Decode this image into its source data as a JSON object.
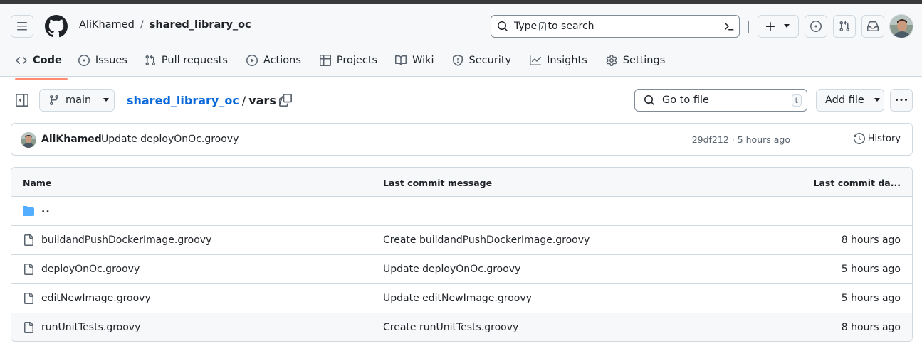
{
  "header": {
    "owner": "AliKhamed",
    "separator": "/",
    "repo": "shared_library_oc",
    "search": {
      "text_before": "Type",
      "key": "/",
      "text_after": "to search"
    },
    "plus_label": "+"
  },
  "tabs": [
    {
      "label": "Code",
      "icon": "code-icon",
      "active": true
    },
    {
      "label": "Issues",
      "icon": "issue-opened-icon"
    },
    {
      "label": "Pull requests",
      "icon": "git-pull-request-icon"
    },
    {
      "label": "Actions",
      "icon": "play-icon"
    },
    {
      "label": "Projects",
      "icon": "table-icon"
    },
    {
      "label": "Wiki",
      "icon": "book-icon"
    },
    {
      "label": "Security",
      "icon": "shield-icon"
    },
    {
      "label": "Insights",
      "icon": "graph-icon"
    },
    {
      "label": "Settings",
      "icon": "gear-icon"
    }
  ],
  "toolbar": {
    "branch": "main",
    "path_repo": "shared_library_oc",
    "path_sep": "/",
    "path_current": "vars",
    "path_trailing": "/",
    "goto_file": "Go to file",
    "goto_key": "t",
    "add_file": "Add file"
  },
  "commit": {
    "author": "AliKhamed",
    "message": "Update deployOnOc.groovy",
    "meta": "29df212 · 5 hours ago",
    "history_label": "History"
  },
  "table": {
    "headers": {
      "name": "Name",
      "message": "Last commit message",
      "date": "Last commit da..."
    },
    "parent_label": "..",
    "rows": [
      {
        "name": "buildandPushDockerImage.groovy",
        "message": "Create buildandPushDockerImage.groovy",
        "date": "8 hours ago"
      },
      {
        "name": "deployOnOc.groovy",
        "message": "Update deployOnOc.groovy",
        "date": "5 hours ago"
      },
      {
        "name": "editNewImage.groovy",
        "message": "Update editNewImage.groovy",
        "date": "5 hours ago"
      },
      {
        "name": "runUnitTests.groovy",
        "message": "Create runUnitTests.groovy",
        "date": "8 hours ago"
      }
    ]
  },
  "colors": {
    "accent": "#0969da",
    "tab_underline": "#fd8c73",
    "folder": "#54aeff"
  }
}
